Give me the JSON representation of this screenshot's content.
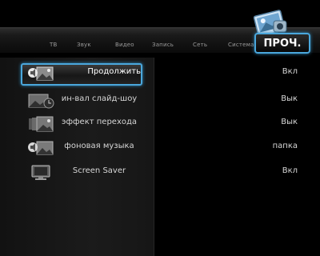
{
  "tabs": [
    {
      "label": "ТВ"
    },
    {
      "label": "Звук"
    },
    {
      "label": "Видео"
    },
    {
      "label": "Запись"
    },
    {
      "label": "Сеть"
    },
    {
      "label": "Система"
    }
  ],
  "active_section": "ПРОЧ.",
  "accent_color": "#4aa7dc",
  "settings": [
    {
      "label": "Продолжить",
      "value": "Вкл",
      "icon": "music-picture-icon",
      "selected": true
    },
    {
      "label": "ин-вал слайд-шоу",
      "value": "Вык",
      "icon": "slideshow-interval-icon",
      "selected": false
    },
    {
      "label": "эффект перехода",
      "value": "Вык",
      "icon": "transition-effect-icon",
      "selected": false
    },
    {
      "label": "фоновая музыка",
      "value": "папка",
      "icon": "background-music-icon",
      "selected": false
    },
    {
      "label": "Screen Saver",
      "value": "Вкл",
      "icon": "screensaver-monitor-icon",
      "selected": false
    }
  ]
}
